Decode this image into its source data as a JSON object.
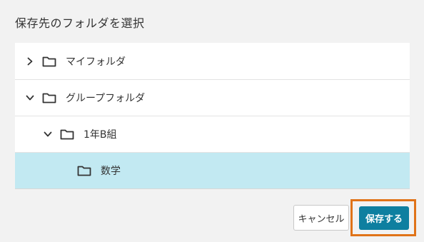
{
  "dialog": {
    "title": "保存先のフォルダを選択"
  },
  "tree": {
    "items": [
      {
        "label": "マイフォルダ",
        "expanded": false,
        "level": 0,
        "icon": "folder-icon"
      },
      {
        "label": "グループフォルダ",
        "expanded": true,
        "level": 0,
        "icon": "folder-icon"
      },
      {
        "label": "1年B組",
        "expanded": true,
        "level": 1,
        "icon": "folder-icon"
      },
      {
        "label": "数学",
        "expanded": false,
        "level": 2,
        "icon": "folder-icon",
        "selected": true
      }
    ]
  },
  "buttons": {
    "cancel_label": "キャンセル",
    "save_label": "保存する"
  },
  "colors": {
    "selected_row": "#c2e9f2",
    "primary_button": "#0e7fa0",
    "focus_ring": "#e07318"
  }
}
